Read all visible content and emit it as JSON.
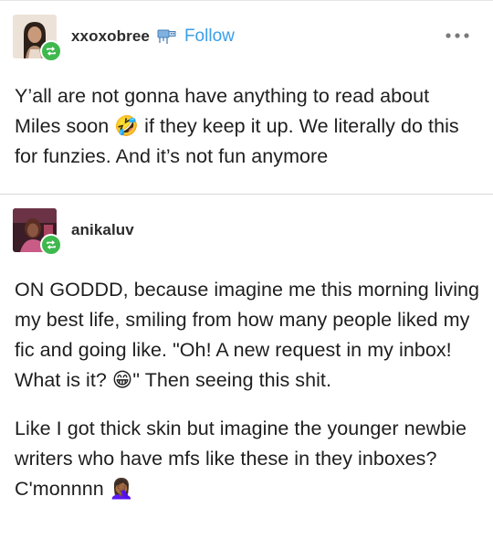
{
  "posts": [
    {
      "username": "xxoxobree",
      "follow_label": "Follow",
      "badge_icon": "blue-usb-badge-icon",
      "more_icon": "more-dots-icon",
      "text": "Y’all are not gonna have anything to read about Miles soon 🤣 if they keep it up. We literally do this for funzies. And it’s not fun anymore"
    },
    {
      "username": "anikaluv",
      "paragraphs": [
        "ON GODDD, because imagine me this morning living my best life, smiling from how many people liked my fic and going like. \"Oh! A new request in my inbox! What is it? 😁\" Then seeing this shit.",
        "Like I got thick skin but imagine the younger newbie writers who have mfs like these in they inboxes? C'monnnn 🤦🏾‍♀️"
      ]
    }
  ],
  "colors": {
    "link": "#3b9ee8",
    "reblog_badge": "#3fb84e",
    "text": "#1e1e1e",
    "divider": "#d8d8d8"
  }
}
